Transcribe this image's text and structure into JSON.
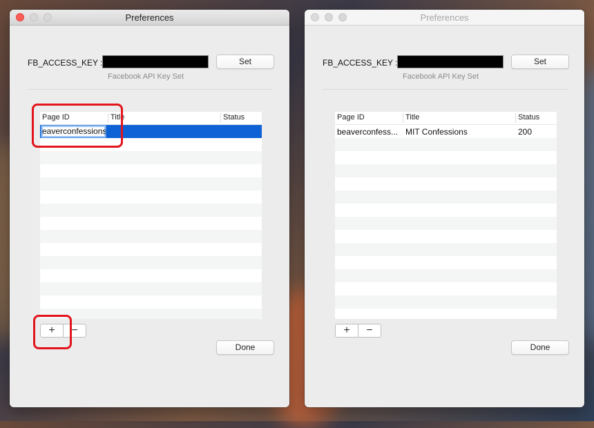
{
  "windows": [
    {
      "title": "Preferences",
      "key_label": "FB_ACCESS_KEY :",
      "set_label": "Set",
      "key_status": "Facebook API Key Set",
      "columns": [
        "Page ID",
        "Title",
        "Status"
      ],
      "editing_value": "eaverconfessions",
      "add_label": "+",
      "remove_label": "−",
      "done_label": "Done"
    },
    {
      "title": "Preferences",
      "key_label": "FB_ACCESS_KEY :",
      "set_label": "Set",
      "key_status": "Facebook API Key Set",
      "columns": [
        "Page ID",
        "Title",
        "Status"
      ],
      "rows": [
        {
          "page_id": "beaverconfess...",
          "title": "MIT Confessions",
          "status": "200"
        }
      ],
      "add_label": "+",
      "remove_label": "−",
      "done_label": "Done"
    }
  ],
  "colors": {
    "selection": "#0f62d6",
    "annotation": "#e3141c",
    "close_button": "#fc5f57"
  }
}
